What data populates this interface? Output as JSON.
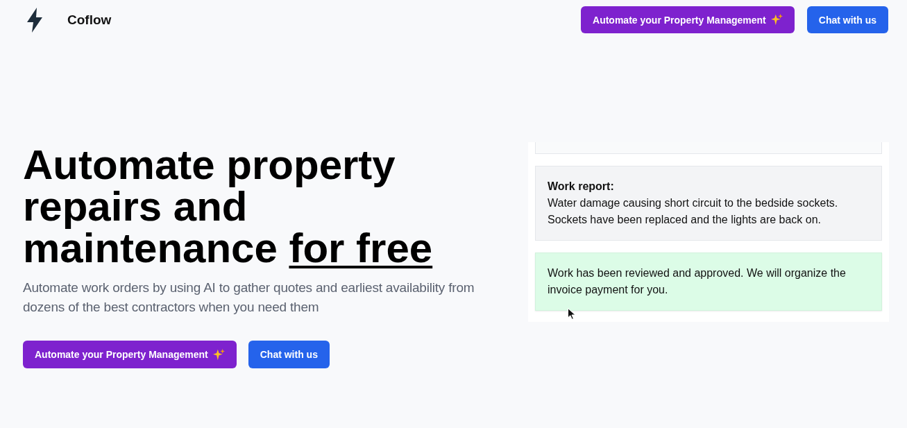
{
  "header": {
    "brand": "Coflow",
    "buttons": [
      {
        "label": "Automate your Property Management",
        "kind": "primary",
        "sparkle": true
      },
      {
        "label": "Chat with us",
        "kind": "secondary",
        "sparkle": false
      }
    ]
  },
  "hero": {
    "headline": "Automate property repairs and maintenance",
    "headline_highlight": "for free",
    "subtitle": "Automate work orders by using AI to gather quotes and earliest availability from dozens of the best contractors when you need them",
    "buttons": [
      {
        "label": "Automate your Property Management",
        "kind": "primary",
        "sparkle": true
      },
      {
        "label": "Chat with us",
        "kind": "secondary",
        "sparkle": false
      }
    ]
  },
  "chat_panel": {
    "messages": [
      {
        "kind": "neutral"
      },
      {
        "kind": "report",
        "title": "Work report:",
        "text": "Water damage causing short circuit to the bedside sockets. Sockets have been replaced and the lights are back on."
      },
      {
        "kind": "approval",
        "text": "Work has been reviewed and approved. We will organize the invoice payment for you."
      }
    ]
  }
}
